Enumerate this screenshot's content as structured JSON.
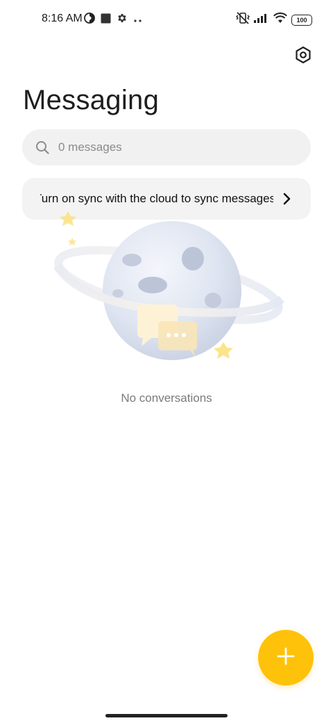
{
  "status_bar": {
    "time": "8:16 AM",
    "battery": "100",
    "left_icons": [
      "data-saver-icon",
      "square-notification-icon",
      "gear-small-icon",
      "more-dots-icon"
    ],
    "right_icons": [
      "vibrate-off-icon",
      "signal-icon",
      "wifi-icon",
      "battery-icon"
    ]
  },
  "header": {
    "title": "Messaging",
    "settings_icon": "settings-hex-icon"
  },
  "search": {
    "placeholder": "0 messages",
    "value": ""
  },
  "sync_banner": {
    "text": "Turn on sync with the cloud to sync messages"
  },
  "empty_state": {
    "text": "No conversations",
    "illustration": "planet-chat-illustration"
  },
  "fab": {
    "icon": "plus-icon",
    "color": "#ffc20a"
  },
  "colors": {
    "accent": "#ffc20a",
    "search_bg": "#f1f1f1",
    "banner_bg": "#f3f3f3"
  }
}
